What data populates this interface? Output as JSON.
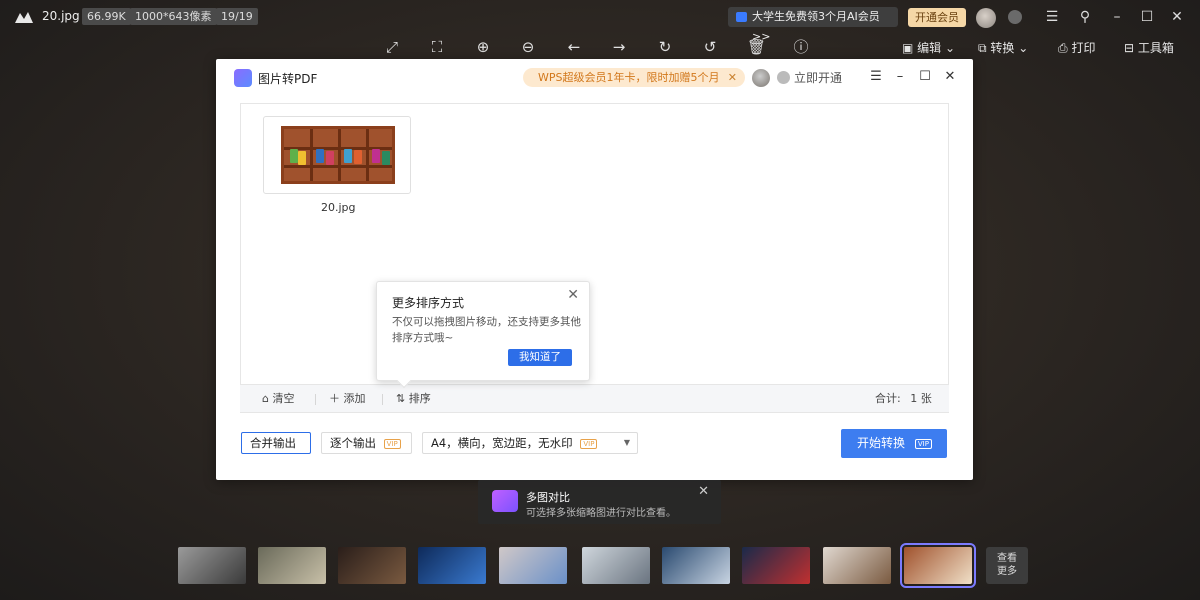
{
  "topbar": {
    "filename": "20.jpg",
    "filesize": "66.99K",
    "dimensions": "1000*643像素",
    "index": "19/19",
    "promo": "大学生免费领3个月AI会员>>",
    "vip_button": "开通会员"
  },
  "toolbar": {
    "edit": "编辑",
    "convert": "转换",
    "print": "打印",
    "toolbox": "工具箱"
  },
  "dialog": {
    "title": "图片转PDF",
    "promo": "WPS超级会员1年卡，限时加赠5个月",
    "open_now": "立即开通",
    "image_name": "20.jpg",
    "actions": {
      "clear": "清空",
      "add": "添加",
      "sort": "排序",
      "total_label": "合计:",
      "total_value": "1 张"
    },
    "tooltip": {
      "title": "更多排序方式",
      "body": "不仅可以拖拽图片移动，还支持更多其他排序方式哦~",
      "button": "我知道了"
    },
    "options": {
      "merge": "合并输出",
      "single": "逐个输出",
      "page_setting": "A4，横向，宽边距，无水印",
      "vip": "VIP"
    },
    "start_button": "开始转换",
    "start_vip": "VIP"
  },
  "hint": {
    "title": "多图对比",
    "body": "可选择多张缩略图进行对比查看。"
  },
  "filmstrip": {
    "more": "查看更多",
    "thumb_colors": [
      [
        "#9a9a9a",
        "#3a3a3a"
      ],
      [
        "#6a6a5a",
        "#c8c0a8"
      ],
      [
        "#2a1e1a",
        "#7a5a40"
      ],
      [
        "#0e2a5a",
        "#3a7ad0"
      ],
      [
        "#d0c8c8",
        "#6a90c8"
      ],
      [
        "#cfd6dc",
        "#6a7480"
      ],
      [
        "#2a4a70",
        "#c8d4e2"
      ],
      [
        "#1a2a4a",
        "#c03030"
      ],
      [
        "#e0d8d0",
        "#7a5a40"
      ],
      [
        "#a0522d",
        "#f0e0c8"
      ]
    ]
  }
}
